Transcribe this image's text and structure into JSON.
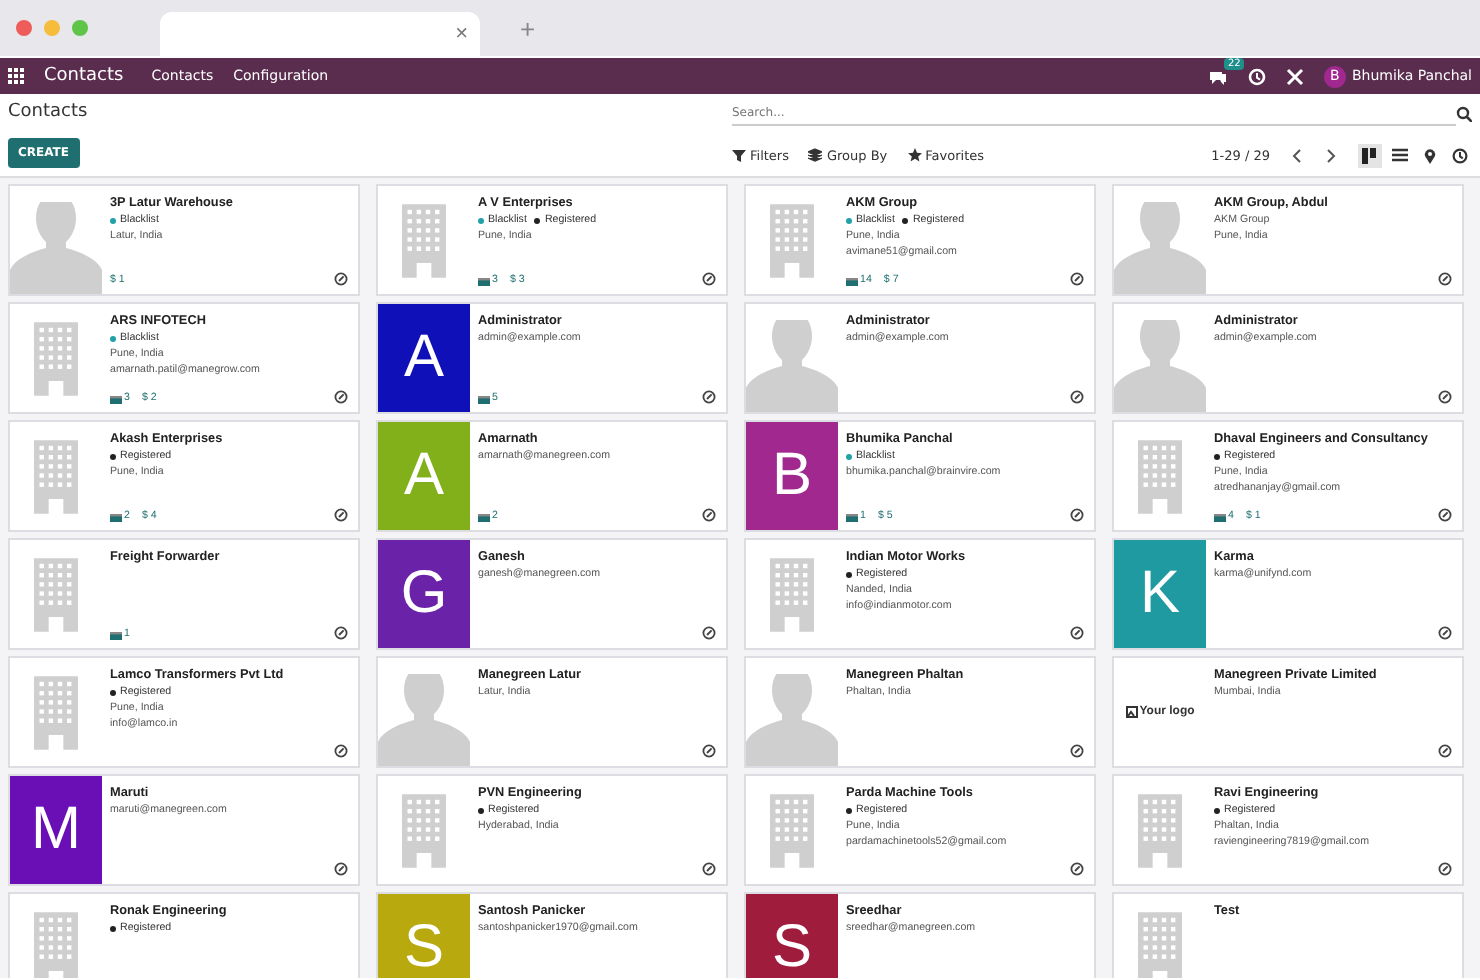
{
  "browser": {
    "tab_close": "×",
    "new_tab": "+"
  },
  "navbar": {
    "app": "Contacts",
    "menus": [
      "Contacts",
      "Configuration"
    ],
    "chat_badge": "22",
    "user_initial": "B",
    "user_name": "Bhumika Panchal"
  },
  "control_panel": {
    "breadcrumb": "Contacts",
    "search": {
      "placeholder": "Search..."
    },
    "create": "CREATE",
    "filters": [
      "Filters",
      "Group By",
      "Favorites"
    ],
    "pager": "1-29 / 29",
    "views": [
      {
        "kind": "kanban",
        "selected": true
      },
      {
        "kind": "list",
        "selected": false
      },
      {
        "kind": "map",
        "selected": false
      },
      {
        "kind": "activity",
        "selected": false
      }
    ]
  },
  "cards": [
    {
      "name": "3P Latur Warehouse",
      "avatar": {
        "kind": "person"
      },
      "tags": [
        {
          "label": "Blacklist",
          "color": "#1fa2a8"
        }
      ],
      "lines": [
        "Latur, India"
      ],
      "opportunities": "$ 1"
    },
    {
      "name": "A V Enterprises",
      "avatar": {
        "kind": "company"
      },
      "tags": [
        {
          "label": "Blacklist",
          "color": "#1fa2a8"
        },
        {
          "label": "Registered",
          "color": "#222222"
        }
      ],
      "lines": [
        "Pune, India"
      ],
      "meetings": "3",
      "opportunities": "$ 3"
    },
    {
      "name": "AKM Group",
      "avatar": {
        "kind": "company"
      },
      "tags": [
        {
          "label": "Blacklist",
          "color": "#1fa2a8"
        },
        {
          "label": "Registered",
          "color": "#222222"
        }
      ],
      "lines": [
        "Pune, India",
        "avimane51@gmail.com"
      ],
      "meetings": "14",
      "opportunities": "$ 7"
    },
    {
      "name": "AKM Group, Abdul",
      "avatar": {
        "kind": "person"
      },
      "lines": [
        "AKM Group",
        "Pune, India"
      ]
    },
    {
      "name": "ARS INFOTECH",
      "avatar": {
        "kind": "company"
      },
      "tags": [
        {
          "label": "Blacklist",
          "color": "#1fa2a8"
        }
      ],
      "lines": [
        "Pune, India",
        "amarnath.patil@manegrow.com"
      ],
      "meetings": "3",
      "opportunities": "$ 2"
    },
    {
      "name": "Administrator",
      "avatar": {
        "kind": "letter",
        "letter": "A",
        "color": "#1010b8"
      },
      "lines": [
        "admin@example.com"
      ],
      "meetings": "5"
    },
    {
      "name": "Administrator",
      "avatar": {
        "kind": "person"
      },
      "lines": [
        "admin@example.com"
      ]
    },
    {
      "name": "Administrator",
      "avatar": {
        "kind": "person"
      },
      "lines": [
        "admin@example.com"
      ]
    },
    {
      "name": "Akash Enterprises",
      "avatar": {
        "kind": "company"
      },
      "tags": [
        {
          "label": "Registered",
          "color": "#222222"
        }
      ],
      "lines": [
        "Pune, India"
      ],
      "meetings": "2",
      "opportunities": "$ 4"
    },
    {
      "name": "Amarnath",
      "avatar": {
        "kind": "letter",
        "letter": "A",
        "color": "#82b01a"
      },
      "lines": [
        "amarnath@manegreen.com"
      ],
      "meetings": "2"
    },
    {
      "name": "Bhumika Panchal",
      "avatar": {
        "kind": "letter",
        "letter": "B",
        "color": "#a0288f"
      },
      "tags": [
        {
          "label": "Blacklist",
          "color": "#1fa2a8"
        }
      ],
      "lines": [
        "bhumika.panchal@brainvire.com"
      ],
      "meetings": "1",
      "opportunities": "$ 5"
    },
    {
      "name": "Dhaval Engineers and Consultancy",
      "avatar": {
        "kind": "company"
      },
      "tags": [
        {
          "label": "Registered",
          "color": "#222222"
        }
      ],
      "lines": [
        "Pune, India",
        "atredhananjay@gmail.com"
      ],
      "meetings": "4",
      "opportunities": "$ 1"
    },
    {
      "name": "Freight Forwarder",
      "avatar": {
        "kind": "company"
      },
      "meetings": "1"
    },
    {
      "name": "Ganesh",
      "avatar": {
        "kind": "letter",
        "letter": "G",
        "color": "#6a22a8"
      },
      "lines": [
        "ganesh@manegreen.com"
      ]
    },
    {
      "name": "Indian Motor Works",
      "avatar": {
        "kind": "company"
      },
      "tags": [
        {
          "label": "Registered",
          "color": "#222222"
        }
      ],
      "lines": [
        "Nanded, India",
        "info@indianmotor.com"
      ]
    },
    {
      "name": "Karma",
      "avatar": {
        "kind": "letter",
        "letter": "K",
        "color": "#1f9aa0"
      },
      "lines": [
        "karma@unifynd.com"
      ]
    },
    {
      "name": "Lamco Transformers Pvt Ltd",
      "avatar": {
        "kind": "company"
      },
      "tags": [
        {
          "label": "Registered",
          "color": "#222222"
        }
      ],
      "lines": [
        "Pune, India",
        "info@lamco.in"
      ]
    },
    {
      "name": "Manegreen Latur",
      "avatar": {
        "kind": "person"
      },
      "lines": [
        "Latur, India"
      ]
    },
    {
      "name": "Manegreen Phaltan",
      "avatar": {
        "kind": "person"
      },
      "lines": [
        "Phaltan, India"
      ]
    },
    {
      "name": "Manegreen Private Limited",
      "avatar": {
        "kind": "logo",
        "text": "Your logo"
      },
      "lines": [
        "Mumbai, India"
      ]
    },
    {
      "name": "Maruti",
      "avatar": {
        "kind": "letter",
        "letter": "M",
        "color": "#6a0fb5"
      },
      "lines": [
        "maruti@manegreen.com"
      ]
    },
    {
      "name": "PVN Engineering",
      "avatar": {
        "kind": "company"
      },
      "tags": [
        {
          "label": "Registered",
          "color": "#222222"
        }
      ],
      "lines": [
        "Hyderabad, India"
      ]
    },
    {
      "name": "Parda Machine Tools",
      "avatar": {
        "kind": "company"
      },
      "tags": [
        {
          "label": "Registered",
          "color": "#222222"
        }
      ],
      "lines": [
        "Pune, India",
        "pardamachinetools52@gmail.com"
      ]
    },
    {
      "name": "Ravi Engineering",
      "avatar": {
        "kind": "company"
      },
      "tags": [
        {
          "label": "Registered",
          "color": "#222222"
        }
      ],
      "lines": [
        "Phaltan, India",
        "raviengineering7819@gmail.com"
      ]
    },
    {
      "name": "Ronak Engineering",
      "avatar": {
        "kind": "company"
      },
      "tags": [
        {
          "label": "Registered",
          "color": "#222222"
        }
      ]
    },
    {
      "name": "Santosh Panicker",
      "avatar": {
        "kind": "letter",
        "letter": "S",
        "color": "#b8a90f"
      },
      "lines": [
        "santoshpanicker1970@gmail.com"
      ]
    },
    {
      "name": "Sreedhar",
      "avatar": {
        "kind": "letter",
        "letter": "S",
        "color": "#a01c3c"
      },
      "lines": [
        "sreedhar@manegreen.com"
      ]
    },
    {
      "name": "Test",
      "avatar": {
        "kind": "company"
      }
    }
  ]
}
